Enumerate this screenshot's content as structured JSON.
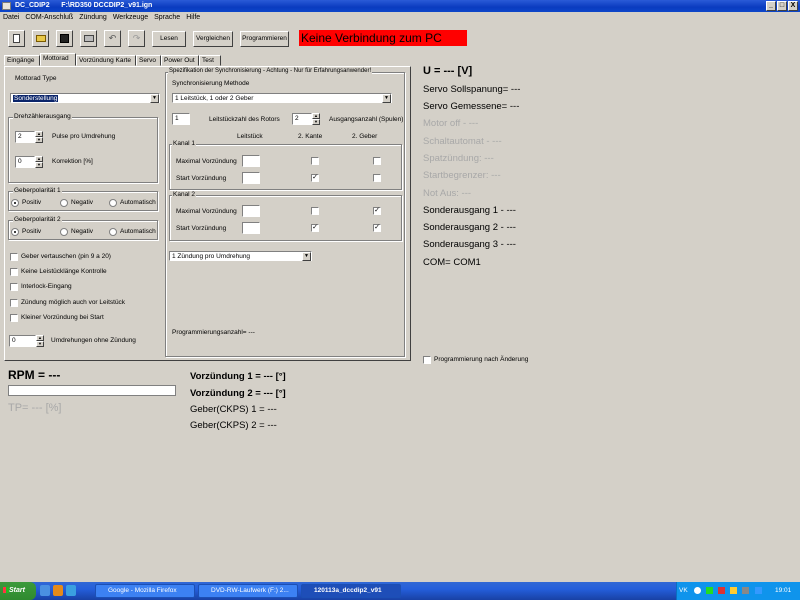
{
  "titlebar": {
    "app": "DC_CDIP2",
    "file": "F:\\RD350 DCCDIP2_v91.ign",
    "min": "_",
    "max": "□",
    "close": "X"
  },
  "menu": [
    "Datei",
    "COM-Anschluß",
    "Zündung",
    "Werkzeuge",
    "Sprache",
    "Hilfe"
  ],
  "toolbar": {
    "read": "Lesen",
    "compare": "Vergleichen",
    "program": "Programmieren",
    "connection_status": "Keine Verbindung zum PC"
  },
  "tabs": [
    "Eingänge",
    "Mottorad",
    "Vorzündung Karte",
    "Servo",
    "Power Out",
    "Test"
  ],
  "mottorad": {
    "type_label": "Mottorad Type",
    "type_value": "Sonderstellung",
    "drehzahl_group": "Drehzählerausgang",
    "pulses_value": "2",
    "pulses_label": "Pulse pro Umdrehung",
    "korrektion_value": "0",
    "korrektion_label": "Korrektion [%]",
    "pol1_group": "Geberpolarität 1",
    "pol2_group": "Geberpolarität 2",
    "pol_options": [
      "Positiv",
      "Negativ",
      "Automatisch"
    ],
    "checks": [
      "Geber vertauschen (pin 9 a 20)",
      "Keine Leistücklänge Kontrolle",
      "Interlock-Eingang",
      "Zündung möglich auch vor Leitstück",
      "Kleiner Vorzündung bei Start"
    ],
    "rev_value": "0",
    "rev_label": "Umdrehungen ohne Zündung"
  },
  "sync": {
    "group": "Spezifikation der Synchronisierung - Achtung - Nur für Erfahrungsanwender!",
    "method_label": "Synchronisierung Methode",
    "method_value": "1 Leitstück, 1 oder 2 Geber",
    "count_value": "1",
    "count_label": "Leitstückzahl des Rotors",
    "output_value": "2",
    "output_label": "Ausgangsanzahl (Spulen)",
    "col_headers": [
      "Leitstück",
      "2. Kante",
      "2. Geber"
    ],
    "channel1": "Kanal 1",
    "channel2": "Kanal 2",
    "row_max": "Maximal Vorzündung",
    "row_start": "Start Vorzündung",
    "ignition_mode": "1 Zündung pro Umdrehung",
    "prog_count": "Programmierungsanzahl= ---"
  },
  "status": {
    "voltage": "U = --- [V]",
    "servo_soll": "Servo Sollspanung= ---",
    "servo_gem": "Servo Gemessene= ---",
    "motor_off": "Motor off - ---",
    "schaltautomat": "Schaltautomat - ---",
    "spatzundung": "Spatzündung: ---",
    "startbegrenzer": "Startbegrenzer: ---",
    "notaus": "Not Aus: ---",
    "sonder1": "Sonderausgang 1 - ---",
    "sonder2": "Sonderausgang 2 - ---",
    "sonder3": "Sonderausgang 3 - ---",
    "com": "COM= COM1",
    "prog_after_change": "Programmierung nach Änderung"
  },
  "bottom": {
    "rpm": "RPM = ---",
    "tp": "TP= --- [%]",
    "vz1": "Vorzündung 1 = --- [°]",
    "vz2": "Vorzündung 2 = --- [°]",
    "geber1": "Geber(CKPS) 1 = ---",
    "geber2": "Geber(CKPS) 2 = ---"
  },
  "taskbar": {
    "start": "Start",
    "items": [
      "Google - Mozilla Firefox",
      "DVD-RW-Laufwerk (F:) 2...",
      "120113a_dccdip2_v91"
    ],
    "lang": "VK",
    "clock": "19:01"
  }
}
